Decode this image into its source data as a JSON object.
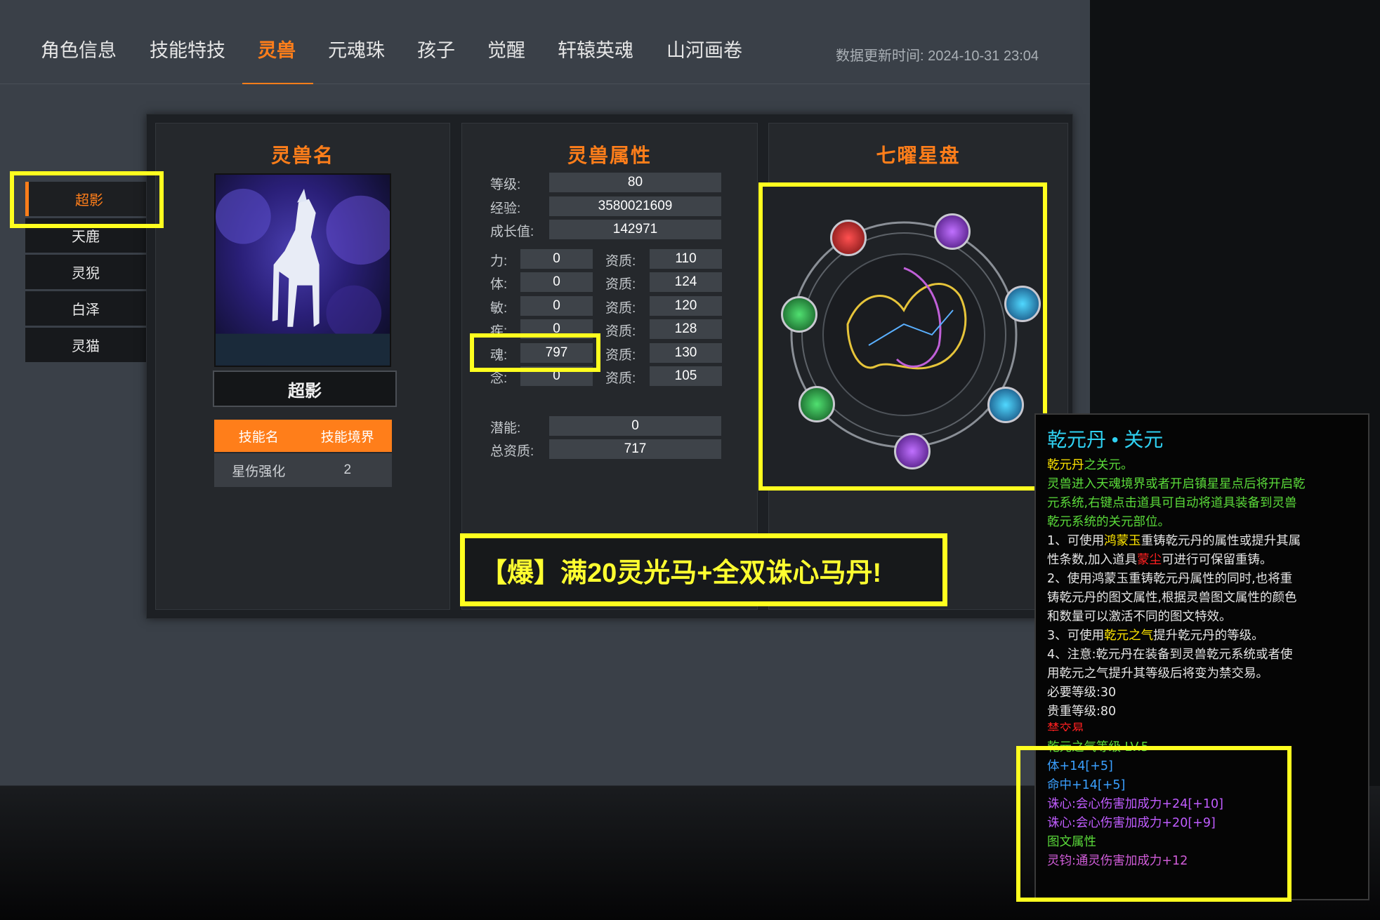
{
  "tabs": [
    "角色信息",
    "技能特技",
    "灵兽",
    "元魂珠",
    "孩子",
    "觉醒",
    "轩辕英魂",
    "山河画卷"
  ],
  "update_time": "数据更新时间:  2024-10-31 23:04",
  "pets": [
    "超影",
    "天鹿",
    "灵猊",
    "白泽",
    "灵猫"
  ],
  "col_titles": {
    "name": "灵兽名",
    "attrs": "灵兽属性",
    "star": "七曜星盘"
  },
  "pet_name": "超影",
  "skills": {
    "header_name": "技能名",
    "header_level": "技能境界",
    "rows": [
      {
        "name": "星伤强化",
        "level": "2"
      }
    ]
  },
  "attrs": {
    "level_label": "等级:",
    "level": "80",
    "exp_label": "经验:",
    "exp": "3580021609",
    "growth_label": "成长值:",
    "growth": "142971",
    "stats": [
      {
        "label": "力:",
        "value": "0",
        "apt_label": "资质:",
        "apt": "110"
      },
      {
        "label": "体:",
        "value": "0",
        "apt_label": "资质:",
        "apt": "124"
      },
      {
        "label": "敏:",
        "value": "0",
        "apt_label": "资质:",
        "apt": "120"
      },
      {
        "label": "疾:",
        "value": "0",
        "apt_label": "资质:",
        "apt": "128"
      },
      {
        "label": "魂:",
        "value": "797",
        "apt_label": "资质:",
        "apt": "130"
      },
      {
        "label": "念:",
        "value": "0",
        "apt_label": "资质:",
        "apt": "105"
      }
    ],
    "potential_label": "潜能:",
    "potential": "0",
    "total_apt_label": "总资质:",
    "total_apt": "717"
  },
  "banner": "【爆】满20灵光马+全双诛心马丹!",
  "tooltip": {
    "title": "乾元丹 • 关元",
    "l1a": "乾元丹",
    "l1b": "之关元。",
    "l2": "灵兽进入天魂境界或者开启镇星星点后将开启乾",
    "l3": "元系统,右键点击道具可自动将道具装备到灵兽",
    "l4": "乾元系统的关元部位。",
    "l5a": "1、可使用",
    "l5b": "鸿蒙玉",
    "l5c": "重铸乾元丹的属性或提升其属",
    "l6a": "性条数,加入道具",
    "l6b": "蒙尘",
    "l6c": "可进行可保留重铸。",
    "l7": "2、使用鸿蒙玉重铸乾元丹属性的同时,也将重",
    "l8": "铸乾元丹的图文属性,根据灵兽图文属性的颜色",
    "l9": "和数量可以激活不同的图文特效。",
    "l10a": "3、可使用",
    "l10b": "乾元之气",
    "l10c": "提升乾元丹的等级。",
    "l11": "4、注意:乾元丹在装备到灵兽乾元系统或者使",
    "l12": "用乾元之气提升其等级后将变为禁交易。",
    "l13": "必要等级:30",
    "l14": "贵重等级:80",
    "l15": "禁交易",
    "l16": "乾元之气等级 LV.5",
    "l17": "体+14[+5]",
    "l18": "命中+14[+5]",
    "l19": "诛心:会心伤害加成力+24[+10]",
    "l20": "诛心:会心伤害加成力+20[+9]",
    "l21": "图文属性",
    "l22": "灵钧:通灵伤害加成力+12"
  },
  "colors": {
    "accent": "#ff7e1a",
    "highlight": "#ffff1f"
  }
}
